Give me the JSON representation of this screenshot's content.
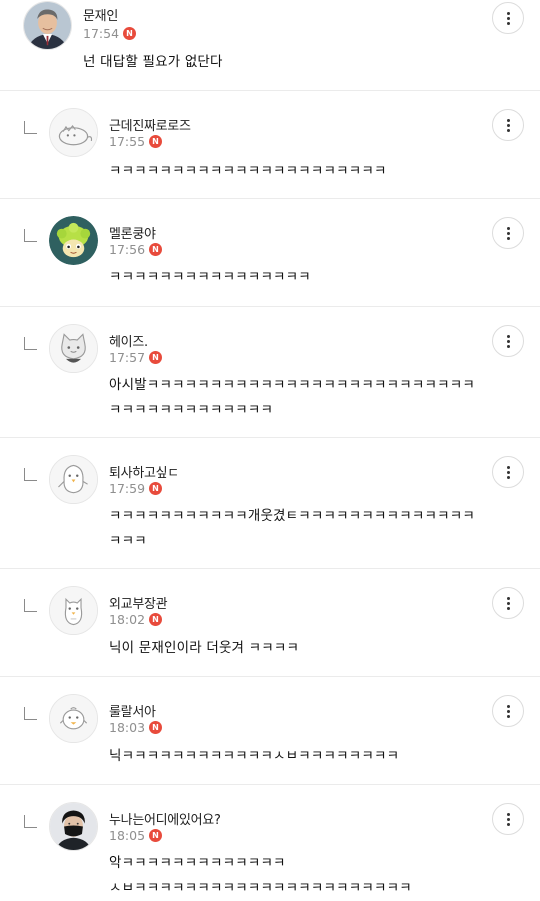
{
  "comments": [
    {
      "nickname": "문재인",
      "time": "17:54",
      "badge": "N",
      "text": "넌 대답할 필요가 없단다",
      "avatar": "photo-man-suit",
      "reply": false
    },
    {
      "nickname": "근데진짜로로즈",
      "time": "17:55",
      "badge": "N",
      "text": "ㅋㅋㅋㅋㅋㅋㅋㅋㅋㅋㅋㅋㅋㅋㅋㅋㅋㅋㅋㅋㅋㅋ",
      "avatar": "gray-creature",
      "reply": true
    },
    {
      "nickname": "멜론쿵야",
      "time": "17:56",
      "badge": "N",
      "text": "ㅋㅋㅋㅋㅋㅋㅋㅋㅋㅋㅋㅋㅋㅋㅋㅋ",
      "avatar": "melon-kungya",
      "reply": true
    },
    {
      "nickname": "헤이즈.",
      "time": "17:57",
      "badge": "N",
      "text": "아시발ㅋㅋㅋㅋㅋㅋㅋㅋㅋㅋㅋㅋㅋㅋㅋㅋㅋㅋㅋㅋㅋㅋㅋㅋㅋㅋ\nㅋㅋㅋㅋㅋㅋㅋㅋㅋㅋㅋㅋㅋ",
      "avatar": "gray-cat",
      "reply": true
    },
    {
      "nickname": "퇴사하고싶ㄷ",
      "time": "17:59",
      "badge": "N",
      "text": "ㅋㅋㅋㅋㅋㅋㅋㅋㅋㅋㅋ개웃겼ㅌㅋㅋㅋㅋㅋㅋㅋㅋㅋㅋㅋㅋㅋㅋ\nㅋㅋㅋ",
      "avatar": "gray-penguin",
      "reply": true
    },
    {
      "nickname": "외교부장관",
      "time": "18:02",
      "badge": "N",
      "text": "닉이 문재인이라 더웃겨 ㅋㅋㅋㅋ",
      "avatar": "gray-bird",
      "reply": true
    },
    {
      "nickname": "룰랄서아",
      "time": "18:03",
      "badge": "N",
      "text": "닉ㅋㅋㅋㅋㅋㅋㅋㅋㅋㅋㅋㅋㅅㅂㅋㅋㅋㅋㅋㅋㅋㅋ",
      "avatar": "gray-chick",
      "reply": true
    },
    {
      "nickname": "누나는어디에있어요?",
      "time": "18:05",
      "badge": "N",
      "text": "악ㅋㅋㅋㅋㅋㅋㅋㅋㅋㅋㅋㅋㅋ\nㅅㅂㅋㅋㅋㅋㅋㅋㅋㅋㅋㅋㅋㅋㅋㅋㅋㅋㅋㅋㅋㅋㅋㅋ",
      "avatar": "photo-man-mask",
      "reply": true
    }
  ]
}
